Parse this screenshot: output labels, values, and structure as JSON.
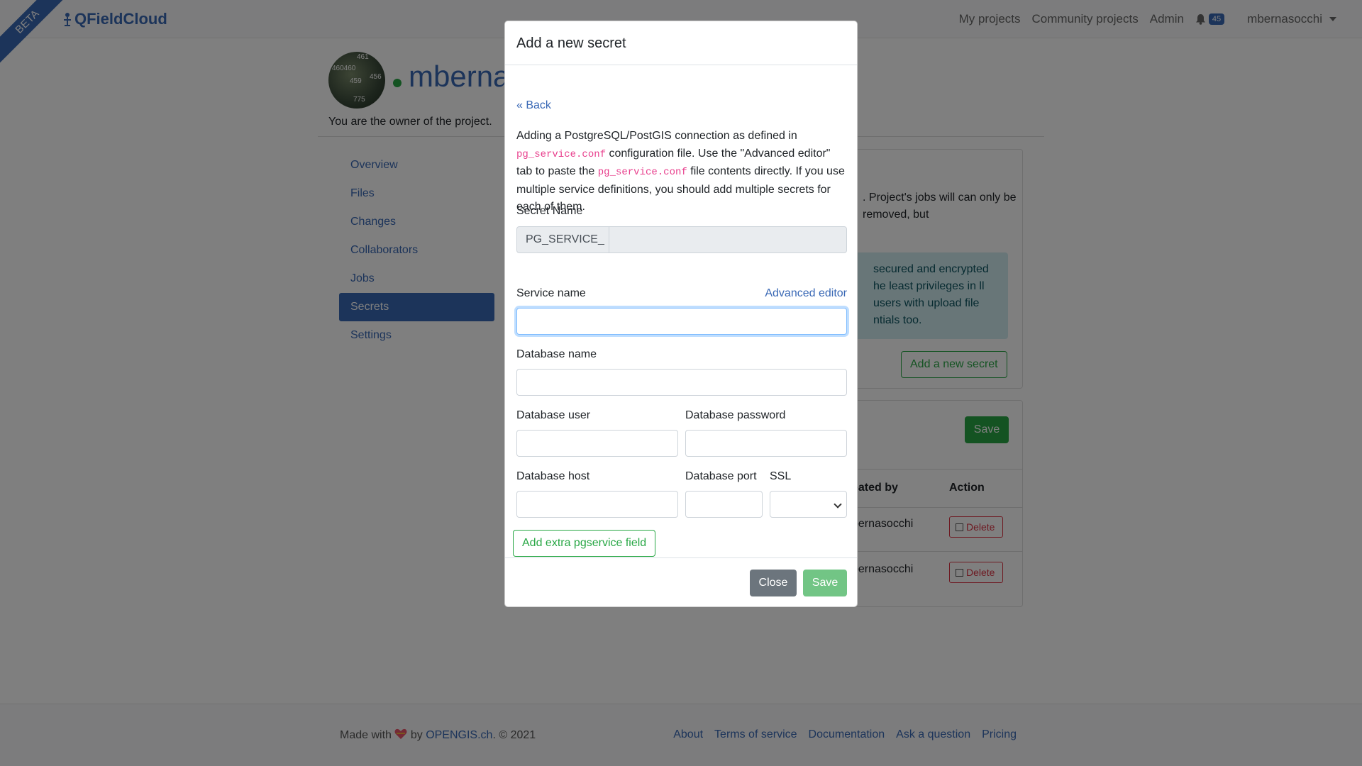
{
  "navbar": {
    "ribbon": "BETA",
    "brand": "QFieldCloud",
    "links": [
      "My projects",
      "Community projects",
      "Admin"
    ],
    "notification_count": "45",
    "username": "mbernasocchi"
  },
  "project": {
    "title": "mberna",
    "owner_text": "You are the owner of the project."
  },
  "sidebar": {
    "items": [
      {
        "label": "Overview"
      },
      {
        "label": "Files"
      },
      {
        "label": "Changes"
      },
      {
        "label": "Collaborators"
      },
      {
        "label": "Jobs"
      },
      {
        "label": "Secrets",
        "active": true
      },
      {
        "label": "Settings"
      }
    ]
  },
  "background": {
    "card_text": ". Project's jobs will can only be removed, but",
    "info_text": "secured and encrypted he least privileges in ll users with upload file ntials too.",
    "add_button": "Add a new secret",
    "save_button": "Save",
    "table_headers": [
      "eated by",
      "Action"
    ],
    "rows": [
      {
        "created_by": "bernasocchi",
        "action": "Delete"
      },
      {
        "created_by": "bernasocchi",
        "action": "Delete"
      }
    ]
  },
  "footer": {
    "made_with": "Made with",
    "by": "by",
    "company": "OPENGIS.ch",
    "year": ". © 2021",
    "links": [
      "About",
      "Terms of service",
      "Documentation",
      "Ask a question",
      "Pricing"
    ]
  },
  "modal": {
    "title": "Add a new secret",
    "back": "« Back",
    "description": {
      "p1": "Adding a PostgreSQL/PostGIS connection as defined in",
      "code1": "pg_service.conf",
      "p2": "configuration file. Use the \"Advanced editor\" tab to paste the",
      "code2": "pg_service.conf",
      "p3": "file contents directly. If you use multiple service definitions, you should add multiple secrets for each of them."
    },
    "secret_name_label": "Secret Name",
    "secret_prefix": "PG_SERVICE_",
    "service_name_label": "Service name",
    "advanced_editor": "Advanced editor",
    "db_name_label": "Database name",
    "db_user_label": "Database user",
    "db_password_label": "Database password",
    "db_host_label": "Database host",
    "db_port_label": "Database port",
    "ssl_label": "SSL",
    "extra_field_button": "Add extra pgservice field",
    "close_button": "Close",
    "save_button": "Save"
  },
  "colors": {
    "brand": "#3968b5",
    "success": "#28a745",
    "danger": "#dc3545"
  }
}
